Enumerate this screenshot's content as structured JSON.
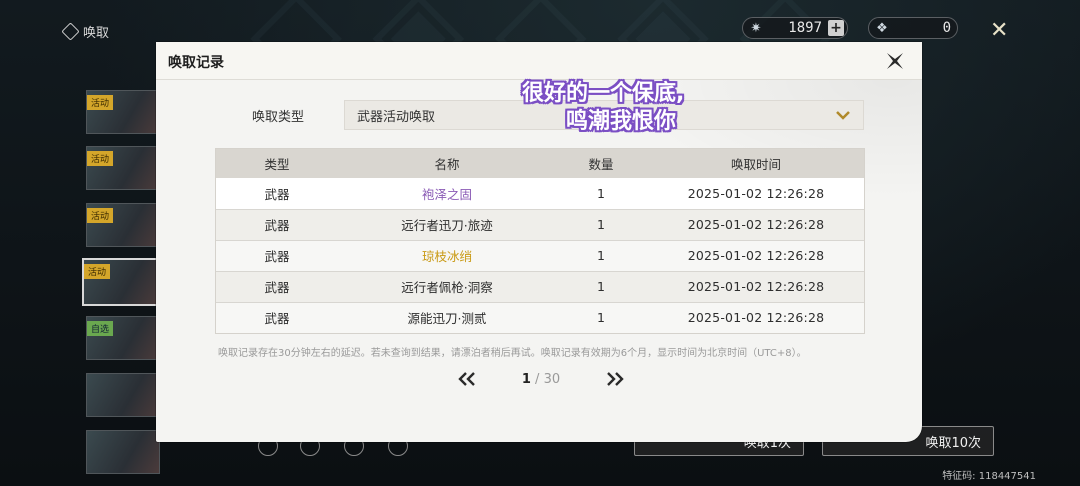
{
  "background": {
    "top_title": "唤取",
    "currencies": [
      {
        "icon": "lunite-icon",
        "value": "1897",
        "has_plus": true
      },
      {
        "icon": "forging-tide-icon",
        "value": "0",
        "has_plus": false
      }
    ],
    "sidebar_tags": [
      "活动",
      "活动",
      "活动",
      "活动",
      "自选"
    ],
    "bottom_buttons": [
      "唤取1次",
      "唤取10次"
    ],
    "feature_code": "特征码: 118447541"
  },
  "modal": {
    "title": "唤取记录",
    "type_label": "唤取类型",
    "type_value": "武器活动唤取",
    "columns": [
      "类型",
      "名称",
      "数量",
      "唤取时间"
    ],
    "rows": [
      {
        "type": "武器",
        "name": "袍泽之固",
        "qty": "1",
        "time": "2025-01-02 12:26:28",
        "rarity": "4"
      },
      {
        "type": "武器",
        "name": "远行者迅刀·旅迹",
        "qty": "1",
        "time": "2025-01-02 12:26:28",
        "rarity": "3"
      },
      {
        "type": "武器",
        "name": "琼枝冰绡",
        "qty": "1",
        "time": "2025-01-02 12:26:28",
        "rarity": "5"
      },
      {
        "type": "武器",
        "name": "远行者佩枪·洞察",
        "qty": "1",
        "time": "2025-01-02 12:26:28",
        "rarity": "3"
      },
      {
        "type": "武器",
        "name": "源能迅刀·测贰",
        "qty": "1",
        "time": "2025-01-02 12:26:28",
        "rarity": "3"
      }
    ],
    "note": "唤取记录存在30分钟左右的延迟。若未查询到结果，请漂泊者稍后再试。唤取记录有效期为6个月，显示时间为北京时间（UTC+8）。",
    "pager": {
      "current": "1",
      "separator": " / ",
      "total": "30"
    }
  },
  "overlay": {
    "line1": "很好的一个保底,",
    "line2": "鸣潮我恨你"
  },
  "colors": {
    "rarity_4": "#8a5ab5",
    "rarity_5": "#c99a14",
    "overlay_stroke": "#7b4fc4"
  }
}
